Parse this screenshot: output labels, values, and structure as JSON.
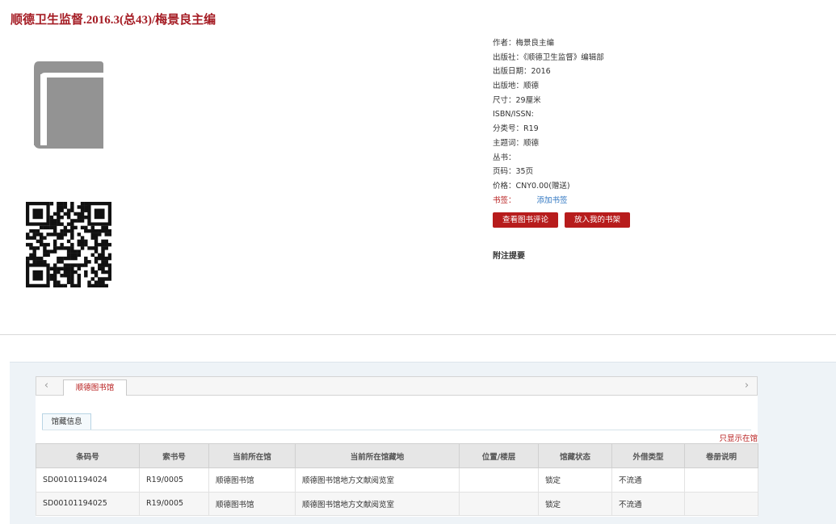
{
  "title": "顺德卫生监督.2016.3(总43)/梅景良主编",
  "metadata": [
    {
      "label": "作者：",
      "value": "梅景良主编"
    },
    {
      "label": "出版社：",
      "value": "《顺德卫生监督》编辑部"
    },
    {
      "label": "出版日期：",
      "value": "2016"
    },
    {
      "label": "出版地：",
      "value": "顺德"
    },
    {
      "label": "尺寸：",
      "value": "29厘米"
    },
    {
      "label": "ISBN/ISSN:",
      "value": ""
    },
    {
      "label": "分类号：",
      "value": "R19"
    },
    {
      "label": "主题词：",
      "value": "顺德"
    },
    {
      "label": "丛书：",
      "value": ""
    },
    {
      "label": "页码：",
      "value": "35页"
    },
    {
      "label": "价格：",
      "value": "CNY0.00(赠送)"
    }
  ],
  "tag": {
    "label": "书签：",
    "add_label": "添加书签"
  },
  "buttons": {
    "review": "查看图书评论",
    "shelf": "放入我的书架"
  },
  "notes_title": "附注提要",
  "tabs": {
    "prev": "‹",
    "next": "›",
    "library": "顺德图书馆"
  },
  "sub_tab": "馆藏信息",
  "only_local": "只显示在馆",
  "table": {
    "headers": [
      "条码号",
      "索书号",
      "当前所在馆",
      "当前所在馆藏地",
      "位置/楼层",
      "馆藏状态",
      "外借类型",
      "卷册说明"
    ],
    "rows": [
      [
        "SD00101194024",
        "R19/0005",
        "顺德图书馆",
        "顺德图书馆地方文献阅览室",
        "",
        "锁定",
        "不流通",
        ""
      ],
      [
        "SD00101194025",
        "R19/0005",
        "顺德图书馆",
        "顺德图书馆地方文献阅览室",
        "",
        "锁定",
        "不流通",
        ""
      ]
    ]
  },
  "colors": {
    "accent": "#b71c1c",
    "link": "#2f76c1",
    "cover": "#939393"
  }
}
